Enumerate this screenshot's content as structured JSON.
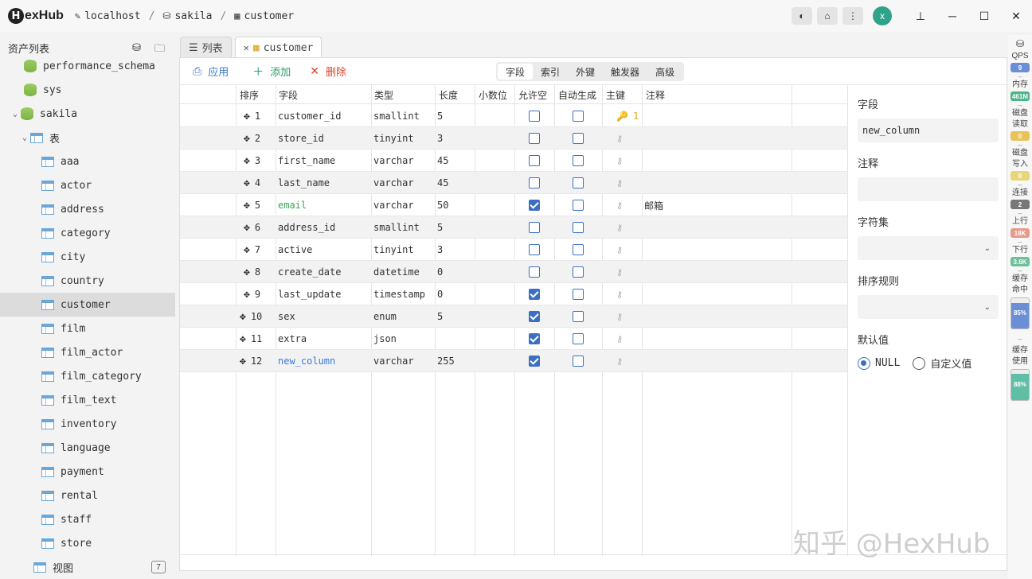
{
  "app": {
    "name": "exHub",
    "logo_letter": "H"
  },
  "breadcrumb": [
    {
      "label": "localhost",
      "icon": "plug-icon"
    },
    {
      "label": "sakila",
      "icon": "database-icon"
    },
    {
      "label": "customer",
      "icon": "table-edit-icon"
    }
  ],
  "user": {
    "avatar_letter": "x"
  },
  "sidebar": {
    "title": "资产列表",
    "items": [
      {
        "label": "performance_schema",
        "type": "db"
      },
      {
        "label": "sys",
        "type": "db"
      },
      {
        "label": "sakila",
        "type": "db"
      },
      {
        "label": "表",
        "type": "group"
      },
      {
        "label": "aaa"
      },
      {
        "label": "actor"
      },
      {
        "label": "address"
      },
      {
        "label": "category"
      },
      {
        "label": "city"
      },
      {
        "label": "country"
      },
      {
        "label": "customer"
      },
      {
        "label": "film"
      },
      {
        "label": "film_actor"
      },
      {
        "label": "film_category"
      },
      {
        "label": "film_text"
      },
      {
        "label": "inventory"
      },
      {
        "label": "language"
      },
      {
        "label": "payment"
      },
      {
        "label": "rental"
      },
      {
        "label": "staff"
      },
      {
        "label": "store"
      }
    ],
    "views": {
      "label": "视图",
      "count": "7"
    }
  },
  "tabs": [
    {
      "label": "列表"
    },
    {
      "label": "customer"
    }
  ],
  "toolbar": {
    "apply": "应用",
    "add": "添加",
    "delete": "删除"
  },
  "subtabs": [
    "字段",
    "索引",
    "外键",
    "触发器",
    "高级"
  ],
  "columns": [
    "排序",
    "字段",
    "类型",
    "长度",
    "小数位",
    "允许空",
    "自动生成",
    "主键",
    "注释"
  ],
  "rows": [
    {
      "n": "1",
      "field": "customer_id",
      "type": "smallint",
      "len": "5",
      "nullable": false,
      "auto": false,
      "pk": "1",
      "comment": ""
    },
    {
      "n": "2",
      "field": "store_id",
      "type": "tinyint",
      "len": "3",
      "nullable": false,
      "auto": false,
      "pk": "",
      "comment": ""
    },
    {
      "n": "3",
      "field": "first_name",
      "type": "varchar",
      "len": "45",
      "nullable": false,
      "auto": false,
      "pk": "",
      "comment": ""
    },
    {
      "n": "4",
      "field": "last_name",
      "type": "varchar",
      "len": "45",
      "nullable": false,
      "auto": false,
      "pk": "",
      "comment": ""
    },
    {
      "n": "5",
      "field": "email",
      "type": "varchar",
      "len": "50",
      "nullable": true,
      "auto": false,
      "pk": "",
      "comment": "邮箱",
      "color": "#3aa55a"
    },
    {
      "n": "6",
      "field": "address_id",
      "type": "smallint",
      "len": "5",
      "nullable": false,
      "auto": false,
      "pk": "",
      "comment": ""
    },
    {
      "n": "7",
      "field": "active",
      "type": "tinyint",
      "len": "3",
      "nullable": false,
      "auto": false,
      "pk": "",
      "comment": ""
    },
    {
      "n": "8",
      "field": "create_date",
      "type": "datetime",
      "len": "0",
      "nullable": false,
      "auto": false,
      "pk": "",
      "comment": ""
    },
    {
      "n": "9",
      "field": "last_update",
      "type": "timestamp",
      "len": "0",
      "nullable": true,
      "auto": false,
      "pk": "",
      "comment": ""
    },
    {
      "n": "10",
      "field": "sex",
      "type": "enum",
      "len": "5",
      "nullable": true,
      "auto": false,
      "pk": "",
      "comment": ""
    },
    {
      "n": "11",
      "field": "extra",
      "type": "json",
      "len": "",
      "nullable": true,
      "auto": false,
      "pk": "",
      "comment": ""
    },
    {
      "n": "12",
      "field": "new_column",
      "type": "varchar",
      "len": "255",
      "nullable": true,
      "auto": false,
      "pk": "",
      "comment": "",
      "color": "#3b7bd8"
    }
  ],
  "props": {
    "field_label": "字段",
    "field_value": "new_column",
    "comment_label": "注释",
    "comment_value": "",
    "charset_label": "字符集",
    "charset_value": "",
    "collation_label": "排序规则",
    "collation_value": "",
    "default_label": "默认值",
    "default_null": "NULL",
    "default_custom": "自定义值"
  },
  "stats": [
    {
      "label": "QPS",
      "value": "9",
      "color": "#6b8fd6"
    },
    {
      "label": "内存",
      "value": "461M",
      "color": "#4eb58a"
    },
    {
      "label": "磁盘读取",
      "value": "0",
      "color": "#e8c35a"
    },
    {
      "label": "磁盘写入",
      "value": "0",
      "color": "#e8d77a"
    },
    {
      "label": "连接",
      "value": "2",
      "color": "#777777"
    },
    {
      "label": "上行",
      "value": "18K",
      "color": "#e89a8a"
    },
    {
      "label": "下行",
      "value": "3.6K",
      "color": "#6fbf9a"
    }
  ],
  "bars": [
    {
      "label": "缓存命中",
      "value": "85%",
      "fill": 0.85,
      "color": "#6b8fd6"
    },
    {
      "label": "缓存使用",
      "value": "88%",
      "fill": 0.88,
      "color": "#5fbfa6"
    }
  ],
  "watermark": "知乎 @HexHub"
}
